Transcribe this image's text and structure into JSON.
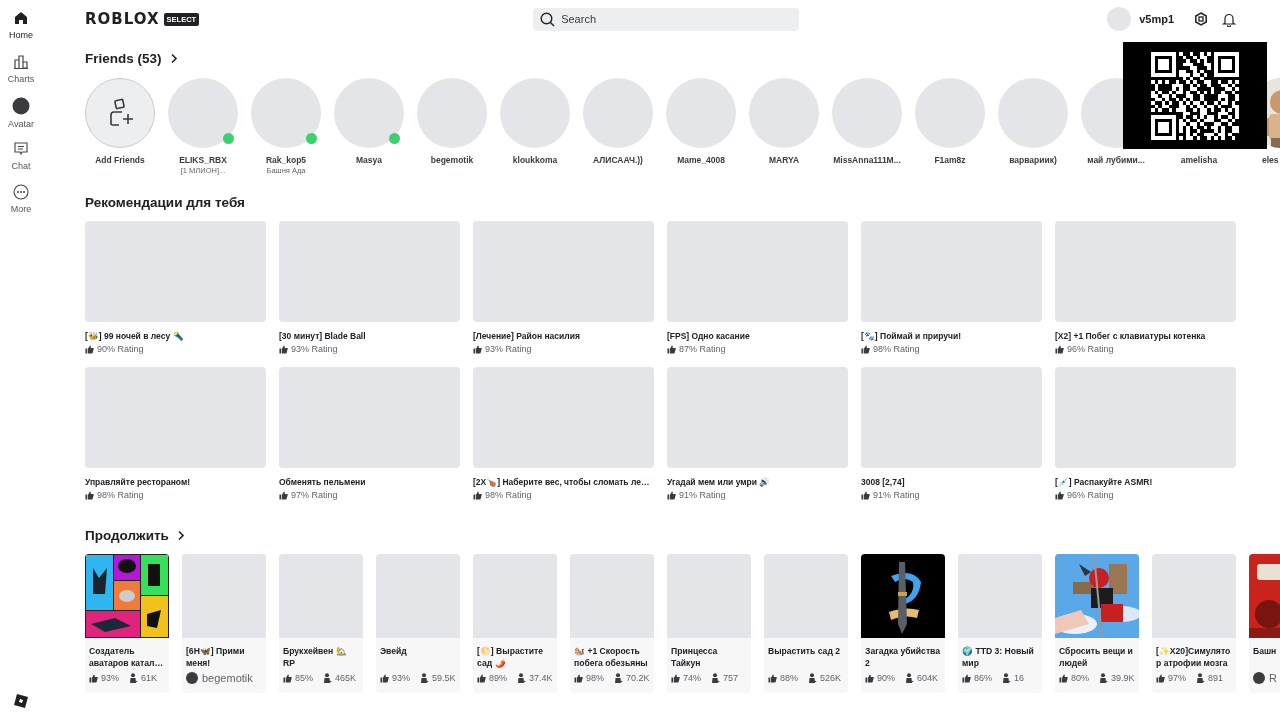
{
  "sidebar": {
    "items": [
      {
        "label": "Home",
        "selected": true
      },
      {
        "label": "Charts",
        "selected": false
      },
      {
        "label": "Avatar",
        "selected": false
      },
      {
        "label": "Chat",
        "selected": false
      },
      {
        "label": "More",
        "selected": false
      }
    ]
  },
  "header": {
    "logo": "ROBLOX",
    "badge": "SELECT",
    "search": {
      "placeholder": "Search"
    },
    "username": "v5mp1"
  },
  "friends": {
    "title": "Friends (53)",
    "add_label": "Add Friends",
    "items": [
      {
        "name": "ELIKS_RBX",
        "status": "[1 МЛИОН]...",
        "online": true
      },
      {
        "name": "Rak_kop5",
        "status": "Башня Ада",
        "online": true
      },
      {
        "name": "Masya",
        "online": true
      },
      {
        "name": "begemotik",
        "online": false
      },
      {
        "name": "kloukkoma",
        "online": false
      },
      {
        "name": "АЛИСААЧ.))",
        "online": false
      },
      {
        "name": "Mame_4008",
        "online": false
      },
      {
        "name": "MARYA",
        "online": false
      },
      {
        "name": "MissAnna111M...",
        "online": false
      },
      {
        "name": "F1am8z",
        "online": false
      },
      {
        "name": "варвариик)",
        "online": false
      },
      {
        "name": "май лубими...",
        "online": false
      },
      {
        "name": "amelisha",
        "online": false
      },
      {
        "name": "eles",
        "online": false,
        "kind": "picture"
      }
    ]
  },
  "recommended": {
    "title": "Рекомендации для тебя",
    "games": [
      {
        "title": "[🐝] 99 ночей в лесу 🔦",
        "rating": "90% Rating"
      },
      {
        "title": "[30 минут] Blade Ball",
        "rating": "93% Rating"
      },
      {
        "title": "[Лечение] Район насилия",
        "rating": "93% Rating"
      },
      {
        "title": "[FPS] Одно касание",
        "rating": "87% Rating"
      },
      {
        "title": "[🐾] Поймай и приручи!",
        "rating": "98% Rating"
      },
      {
        "title": "[X2] +1 Побег с клавиатуры котенка",
        "rating": "96% Rating"
      },
      {
        "title": "Управляйте рестораном!",
        "rating": "98% Rating"
      },
      {
        "title": "Обменять пельмени",
        "rating": "97% Rating"
      },
      {
        "title": "[2X🍗] Наберите вес, чтобы сломать ле…",
        "rating": "98% Rating"
      },
      {
        "title": "Угадай мем или умри 🔊",
        "rating": "91% Rating"
      },
      {
        "title": "3008 [2,74]",
        "rating": "91% Rating"
      },
      {
        "title": "[💉] Распакуйте ASMR!",
        "rating": "96% Rating"
      }
    ]
  },
  "continue": {
    "title": "Продолжить",
    "games": [
      {
        "title": "Создатель аватаров катал…",
        "kind": "stats",
        "rating": "93%",
        "players": "61K",
        "picture": true
      },
      {
        "title": "[6H🦋] Прими меня!",
        "kind": "creator",
        "creator": "begemotik",
        "picture": false
      },
      {
        "title": "Брукхейвен 🏡 RP",
        "kind": "stats",
        "rating": "85%",
        "players": "465K",
        "picture": false
      },
      {
        "title": "Эвейд",
        "kind": "stats",
        "rating": "93%",
        "players": "59.5K",
        "picture": false
      },
      {
        "title": "[🌕] Вырастите сад 🌶️",
        "kind": "stats",
        "rating": "89%",
        "players": "37.4K",
        "picture": false
      },
      {
        "title": "🐿️ +1 Скорость побега обезьяны",
        "kind": "stats",
        "rating": "98%",
        "players": "70.2K",
        "picture": false
      },
      {
        "title": "Принцесса Тайкун",
        "kind": "stats",
        "rating": "74%",
        "players": "757",
        "picture": false
      },
      {
        "title": "Вырастить сад 2",
        "kind": "stats",
        "rating": "88%",
        "players": "526K",
        "picture": false
      },
      {
        "title": "Загадка убийства 2",
        "kind": "stats",
        "rating": "90%",
        "players": "604K",
        "picture": true
      },
      {
        "title": "🌍 TTD 3: Новый мир",
        "kind": "stats",
        "rating": "86%",
        "players": "16",
        "picture": false
      },
      {
        "title": "Сбросить вещи и людей",
        "kind": "stats",
        "rating": "80%",
        "players": "39.9K",
        "picture": true
      },
      {
        "title": "[✨X20]Симулятор атрофии мозга",
        "kind": "stats",
        "rating": "97%",
        "players": "891",
        "picture": false
      },
      {
        "title": "Башн",
        "kind": "creator",
        "creator": "R",
        "picture": true
      }
    ]
  }
}
